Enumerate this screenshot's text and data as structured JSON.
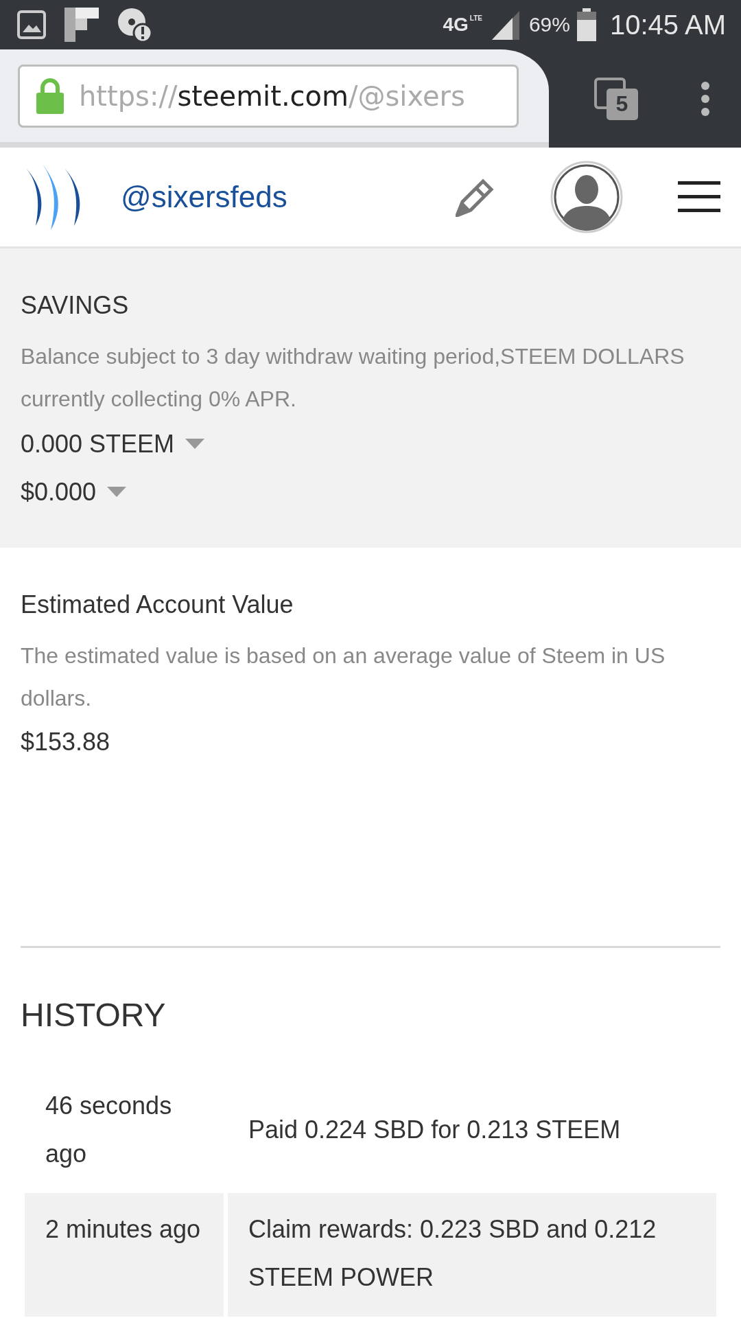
{
  "status_bar": {
    "network": "4G",
    "network_sub": "LTE",
    "battery": "69%",
    "time": "10:45 AM"
  },
  "browser": {
    "url": {
      "scheme": "https://",
      "host": "steemit.com",
      "path": "/@sixers"
    },
    "tab_count": "5"
  },
  "header": {
    "username": "@sixersfeds"
  },
  "savings": {
    "title": "SAVINGS",
    "description": "Balance subject to 3 day withdraw waiting period,STEEM DOLLARS currently collecting 0% APR.",
    "balances": [
      "0.000 STEEM",
      "$0.000"
    ]
  },
  "account_value": {
    "title": "Estimated Account Value",
    "description": "The estimated value is based on an average value of Steem in US dollars.",
    "value": "$153.88"
  },
  "history": {
    "title": "HISTORY",
    "rows": [
      {
        "time": "46 seconds ago",
        "description": "Paid 0.224 SBD for 0.213 STEEM"
      },
      {
        "time": "2 minutes ago",
        "description": "Claim rewards: 0.223 SBD and 0.212 STEEM POWER"
      }
    ]
  }
}
